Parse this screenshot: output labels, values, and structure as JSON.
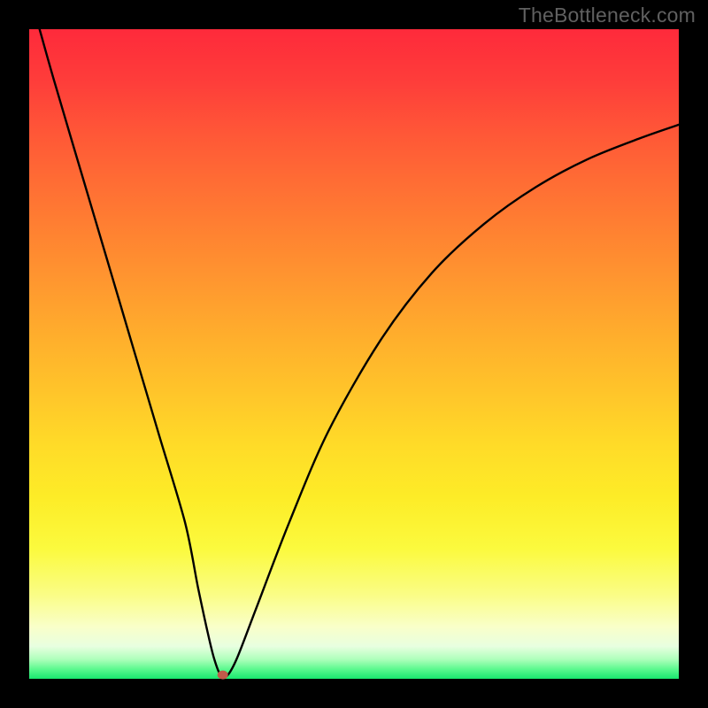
{
  "watermark": "TheBottleneck.com",
  "chart_data": {
    "type": "line",
    "title": "",
    "xlabel": "",
    "ylabel": "",
    "xlim": [
      0,
      100
    ],
    "ylim": [
      0,
      100
    ],
    "grid": false,
    "legend": false,
    "note": "Axes are not labeled in the image; x and y expressed as 0–100 percent of the plot area. Values are visually estimated from the rendered curve.",
    "series": [
      {
        "name": "curve",
        "x": [
          1.6,
          4,
          8,
          12,
          16,
          20,
          24,
          26,
          27.5,
          28.5,
          29.5,
          30.5,
          32,
          35,
          40,
          46,
          54,
          62,
          70,
          78,
          86,
          94,
          100
        ],
        "y": [
          100,
          91.5,
          78,
          64.5,
          51,
          37.5,
          24,
          14,
          7,
          3,
          0.5,
          0.5,
          3.2,
          11,
          24,
          38,
          52,
          62.5,
          70,
          75.7,
          80,
          83.2,
          85.3
        ]
      }
    ],
    "marker": {
      "x": 29.8,
      "y": 0.6,
      "color": "#c05a4a"
    },
    "background_gradient": {
      "top": "#fe2a3b",
      "mid": "#ffdb28",
      "bottom": "#19e86e"
    }
  }
}
